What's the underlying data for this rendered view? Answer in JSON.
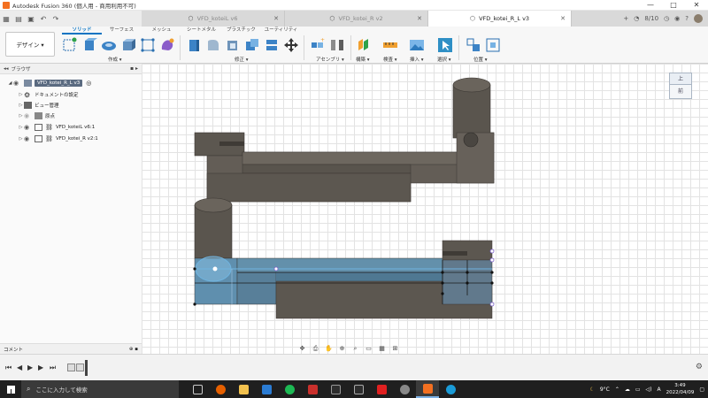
{
  "window": {
    "title": "Autodesk Fusion 360 (個人用 - 商用利用不可)",
    "minimize": "—",
    "maximize": "□",
    "close": "✕"
  },
  "tabs": [
    {
      "label": "VFD_koteiL v6",
      "active": false
    },
    {
      "label": "VFD_kotei_R v2",
      "active": false
    },
    {
      "label": "VFD_kotei_R_L v3",
      "active": true
    }
  ],
  "tabbar_right": {
    "jobs": "8/10"
  },
  "toolbar": {
    "workspace": "デザイン ▾",
    "workspace_tabs": [
      "ソリッド",
      "サーフェス",
      "メッシュ",
      "シートメタル",
      "プラスチック",
      "ユーティリティ"
    ],
    "groups": [
      "作成 ▾",
      "修正 ▾",
      "アセンブリ ▾",
      "構築 ▾",
      "検査 ▾",
      "挿入 ▾",
      "選択 ▾",
      "位置 ▾"
    ]
  },
  "browser": {
    "title": "ブラウザ",
    "root": "VFD_kotei_R_L v3",
    "items": [
      "ドキュメントの設定",
      "ビュー管理",
      "原点",
      "VFD_koteiL v6:1",
      "VFD_kotei_R v2:1"
    ]
  },
  "comments": {
    "title": "コメント"
  },
  "viewcube": {
    "top": "上",
    "front": "前"
  },
  "taskbar": {
    "search_placeholder": "ここに入力して検索",
    "weather": "9°C",
    "time": "3:49",
    "date": "2022/04/09"
  },
  "colors": {
    "accent": "#0a74c2",
    "model_body": "#605a53",
    "selection": "#6fb4e0"
  }
}
